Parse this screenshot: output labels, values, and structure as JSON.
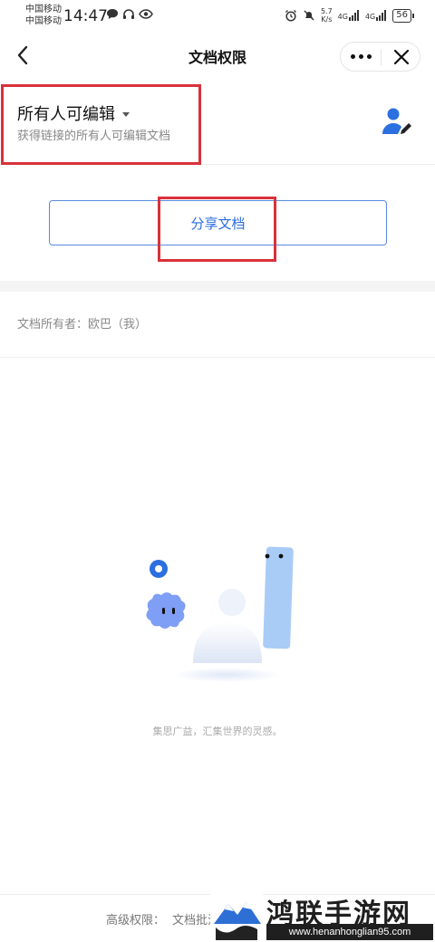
{
  "status_bar": {
    "carrier_1": "中国移动",
    "carrier_2": "中国移动",
    "time": "14:47",
    "net_speed": "5.7",
    "net_unit": "K/s",
    "sig_1": "4G",
    "sig_2": "4G",
    "battery": "56"
  },
  "nav": {
    "title": "文档权限"
  },
  "permission": {
    "title": "所有人可编辑",
    "subtitle": "获得链接的所有人可编辑文档"
  },
  "share_button_label": "分享文档",
  "owner_text": "文档所有者：欧巴（我）",
  "tagline": "集思广益，汇集世界的灵感。",
  "footer": {
    "label": "高级权限：",
    "item": "文档批注"
  },
  "watermark": {
    "title": "鸿联手游网",
    "url": "www.henanhonglian95.com"
  },
  "colors": {
    "accent": "#2a6be0",
    "annotation_red": "#d9313b"
  }
}
